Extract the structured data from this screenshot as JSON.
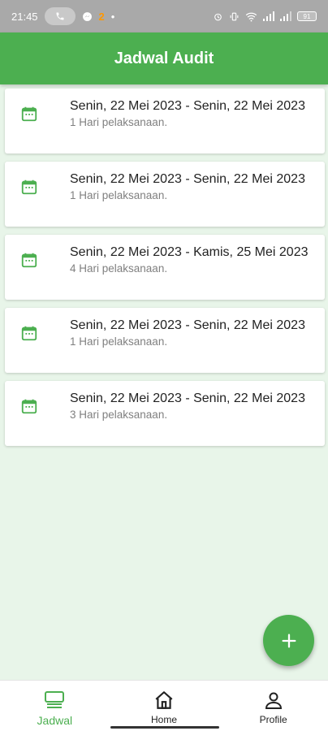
{
  "status_bar": {
    "time": "21:45",
    "notification_count": "2",
    "dot": "•",
    "battery": "91"
  },
  "app_bar": {
    "title": "Jadwal Audit"
  },
  "schedules": [
    {
      "title": "Senin, 22 Mei 2023 - Senin, 22 Mei 2023",
      "subtitle": "1 Hari pelaksanaan."
    },
    {
      "title": "Senin, 22 Mei 2023 - Senin, 22 Mei 2023",
      "subtitle": "1 Hari pelaksanaan."
    },
    {
      "title": "Senin, 22 Mei 2023 - Kamis, 25 Mei 2023",
      "subtitle": "4 Hari pelaksanaan."
    },
    {
      "title": "Senin, 22 Mei 2023 - Senin, 22 Mei 2023",
      "subtitle": "1 Hari pelaksanaan."
    },
    {
      "title": "Senin, 22 Mei 2023 - Senin, 22 Mei 2023",
      "subtitle": "3 Hari pelaksanaan."
    }
  ],
  "fab": {
    "icon": "plus-icon"
  },
  "bottom_nav": {
    "items": [
      {
        "label": "Jadwal",
        "icon": "list-icon",
        "active": true
      },
      {
        "label": "Home",
        "icon": "home-icon",
        "active": false
      },
      {
        "label": "Profile",
        "icon": "person-icon",
        "active": false
      }
    ]
  },
  "colors": {
    "primary": "#4caf50",
    "background": "#e8f5e9",
    "status_bar": "#a9a9a9"
  }
}
